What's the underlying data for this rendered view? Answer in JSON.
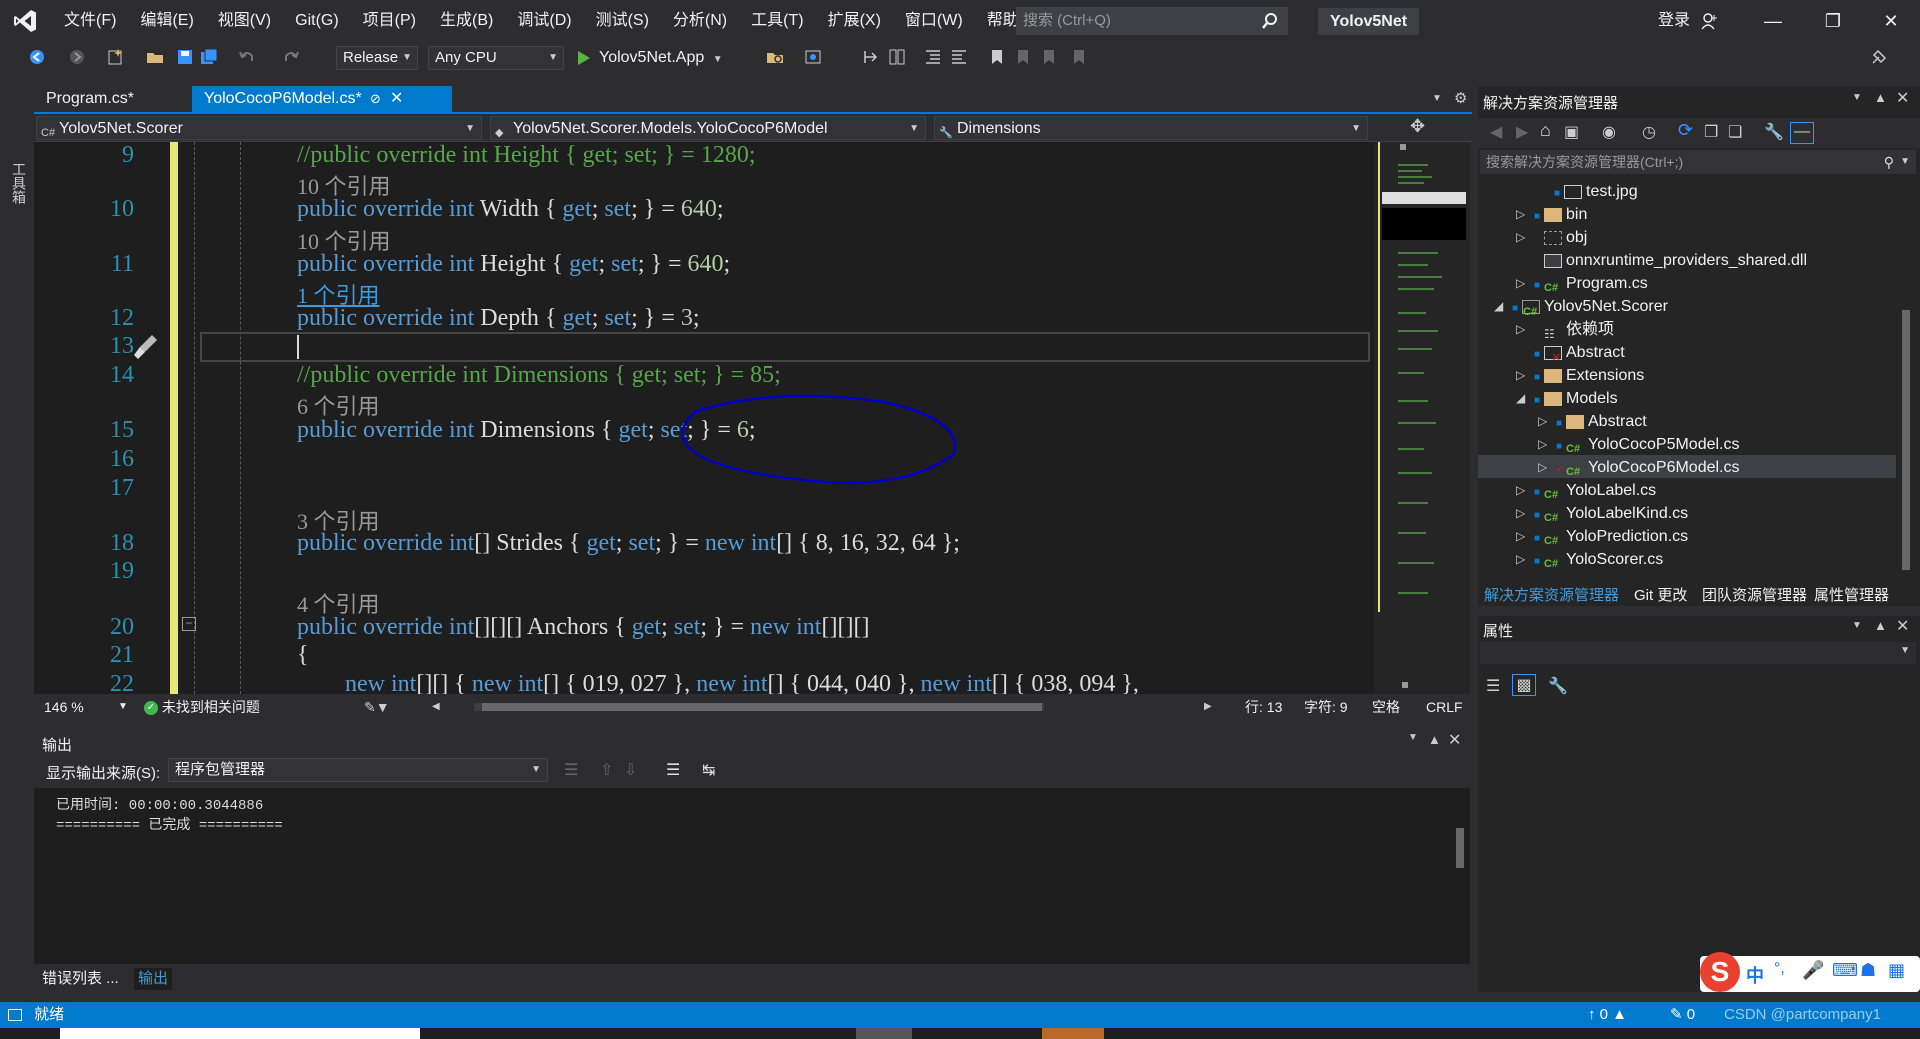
{
  "menu": [
    "文件(F)",
    "编辑(E)",
    "视图(V)",
    "Git(G)",
    "项目(P)",
    "生成(B)",
    "调试(D)",
    "测试(S)",
    "分析(N)",
    "工具(T)",
    "扩展(X)",
    "窗口(W)",
    "帮助(H)"
  ],
  "search": {
    "placeholder": "搜索 (Ctrl+Q)"
  },
  "solution_name": "Yolov5Net",
  "signin_label": "登录",
  "toolbar": {
    "config": "Release",
    "platform": "Any CPU",
    "run_target": "Yolov5Net.App"
  },
  "left_strip_label": "工具箱",
  "tabs": [
    {
      "label": "Program.cs*"
    },
    {
      "label": "YolocCocoP6Model.cs*"
    }
  ],
  "nav": {
    "project": "Yolov5Net.Scorer",
    "type": "Yolov5Net.Scorer.Models.YoloCocoP6Model",
    "member": "Dimensions"
  },
  "code": {
    "line_numbers": [
      "9",
      "10",
      "11",
      "12",
      "13",
      "14",
      "15",
      "16",
      "17",
      "18",
      "19",
      "20",
      "21",
      "22"
    ],
    "refs": {
      "r10": "10 个引用",
      "r11": "10 个引用",
      "r12": "1 个引用",
      "r15": "6 个引用",
      "r18": "3 个引用",
      "r20": "4 个引用"
    },
    "lines": {
      "l9_comment": "//public override int Height { get; set; } = 1280;",
      "l10_kw": "public override int ",
      "l10_name": "Width",
      "l10_rest": " { get; set; } = 640;",
      "l11_kw": "public override int ",
      "l11_name": "Height",
      "l11_rest": " { get; set; } = 640;",
      "l12_kw": "public override int ",
      "l12_name": "Depth",
      "l12_rest": " { get; set; } = 3;",
      "l14_comment": "//public override int Dimensions { get; set; } = 85;",
      "l15_kw": "public override int ",
      "l15_name": "Dimensions",
      "l15_rest": " { get; set; } = 6;",
      "l18_kw": "public override int",
      "l18_rest1": "[] Strides { ",
      "l18_get": "get",
      "l18_mid": "; ",
      "l18_set": "set",
      "l18_mid2": "; } = ",
      "l18_new": "new int",
      "l18_tail": "[] { 8, 16, 32, 64 };",
      "l20_kw": "public override int",
      "l20_rest1": "[][][] Anchors { ",
      "l20_get": "get",
      "l20_mid": "; ",
      "l20_set": "set",
      "l20_mid2": "; } = ",
      "l20_new": "new int",
      "l20_tail": "[][][]",
      "l21": "{",
      "l22_new1": "new int",
      "l22_a": "[][] { ",
      "l22_new2": "new int",
      "l22_b": "[] { 019, 027 }, ",
      "l22_new3": "new int",
      "l22_c": "[] { 044, 040 }, ",
      "l22_new4": "new int",
      "l22_d": "[] { 038, 094 },"
    }
  },
  "editor_status": {
    "zoom": "146 %",
    "issues": "未找到相关问题",
    "line": "行: 13",
    "col": "字符: 9",
    "spaces": "空格",
    "eol": "CRLF"
  },
  "output": {
    "title": "输出",
    "source_label": "显示输出来源(S):",
    "source_value": "程序包管理器",
    "text": "已用时间: 00:00:00.3044886\n========== 已完成 =========="
  },
  "bottom_tabs": [
    "错误列表 ...",
    "输出"
  ],
  "solution_explorer": {
    "title": "解决方案资源管理器",
    "search_placeholder": "搜索解决方案资源管理器(Ctrl+;)",
    "items": [
      {
        "label": "test.jpg"
      },
      {
        "label": "bin"
      },
      {
        "label": "obj"
      },
      {
        "label": "onnxruntime_providers_shared.dll"
      },
      {
        "label": "Program.cs"
      },
      {
        "label": "Yolov5Net.Scorer"
      },
      {
        "label": "依赖项"
      },
      {
        "label": "Abstract"
      },
      {
        "label": "Extensions"
      },
      {
        "label": "Models"
      },
      {
        "label": "Abstract"
      },
      {
        "label": "YoloCocoP5Model.cs"
      },
      {
        "label": "YoloCocoP6Model.cs"
      },
      {
        "label": "YoloLabel.cs"
      },
      {
        "label": "YoloLabelKind.cs"
      },
      {
        "label": "YoloPrediction.cs"
      },
      {
        "label": "YoloScorer.cs"
      }
    ],
    "tabs": [
      "解决方案资源管理器",
      "Git 更改",
      "团队资源管理器",
      "属性管理器"
    ]
  },
  "properties": {
    "title": "属性"
  },
  "statusbar": {
    "ready": "就绪",
    "up_count": "0",
    "edit_count": "0",
    "watermark": "CSDN @partcompany1"
  },
  "ime": {
    "zh": "中"
  },
  "colors": {
    "accent": "#007acc",
    "annotation": "#0000cc"
  }
}
